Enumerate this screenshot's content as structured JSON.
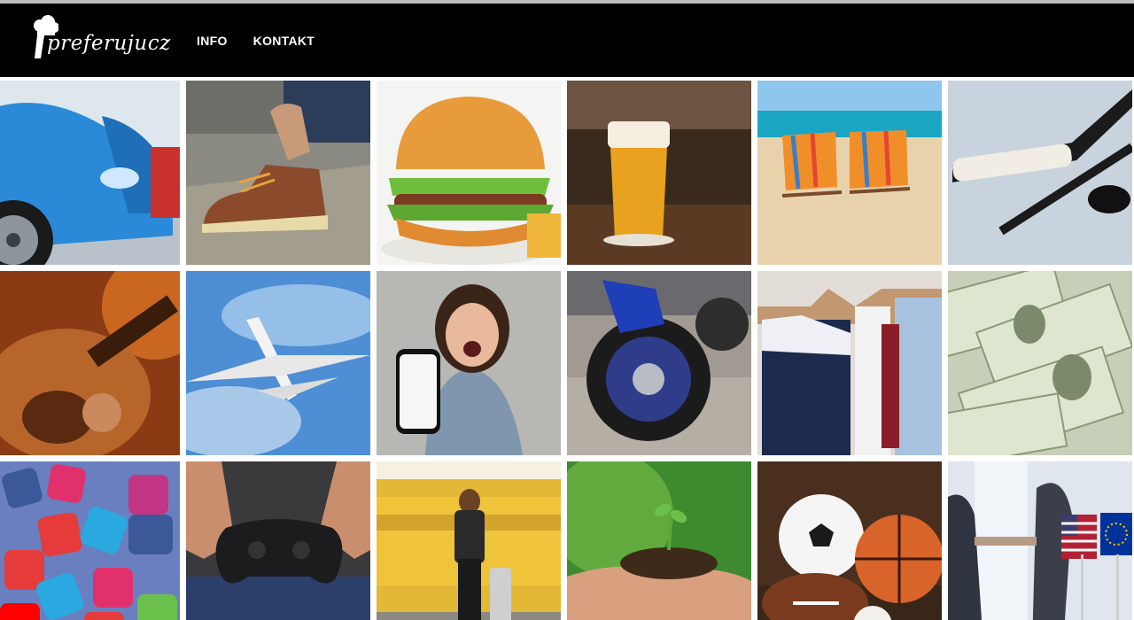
{
  "header": {
    "logo_text": "preferujucz",
    "nav": [
      {
        "label": "INFO"
      },
      {
        "label": "KONTAKT"
      }
    ]
  },
  "tiles": [
    {
      "subject": "cars",
      "icon": "car-icon"
    },
    {
      "subject": "shoes",
      "icon": "boot-icon"
    },
    {
      "subject": "burger",
      "icon": "burger-icon"
    },
    {
      "subject": "beer",
      "icon": "beer-icon"
    },
    {
      "subject": "beach",
      "icon": "beach-chair-icon"
    },
    {
      "subject": "hockey",
      "icon": "hockey-stick-icon"
    },
    {
      "subject": "guitar",
      "icon": "guitar-icon"
    },
    {
      "subject": "airplane",
      "icon": "airplane-icon"
    },
    {
      "subject": "phone",
      "icon": "smartphone-icon"
    },
    {
      "subject": "motorcycle",
      "icon": "motorcycle-icon"
    },
    {
      "subject": "clothes",
      "icon": "clothes-hanger-icon"
    },
    {
      "subject": "money",
      "icon": "banknote-icon"
    },
    {
      "subject": "social media",
      "icon": "social-media-icon"
    },
    {
      "subject": "gaming",
      "icon": "gamepad-icon"
    },
    {
      "subject": "travel",
      "icon": "suitcase-icon"
    },
    {
      "subject": "plant",
      "icon": "seedling-icon"
    },
    {
      "subject": "sports balls",
      "icon": "ball-icon"
    },
    {
      "subject": "business",
      "icon": "handshake-icon"
    }
  ]
}
